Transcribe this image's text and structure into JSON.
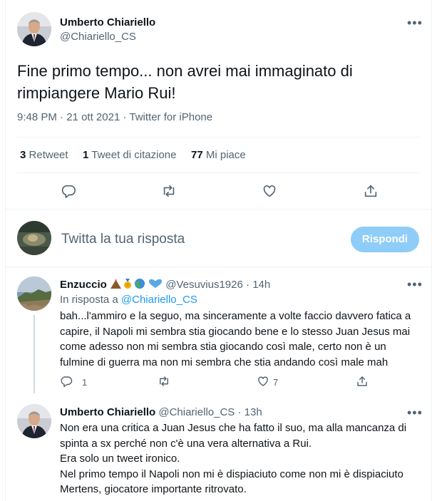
{
  "main_tweet": {
    "author_name": "Umberto Chiariello",
    "handle": "@Chiariello_CS",
    "text_line1": "Fine primo tempo... non avrei mai immaginato di",
    "text_line2": "rimpiangere Mario Rui!",
    "time": "9:48 PM",
    "date": "21 ott 2021",
    "source": "Twitter for iPhone",
    "sep": "·",
    "retweets_count": "3",
    "retweets_label": "Retweet",
    "quotes_count": "1",
    "quotes_label": "Tweet di citazione",
    "likes_count": "77",
    "likes_label": "Mi piace",
    "more": "•••"
  },
  "compose": {
    "placeholder": "Twitta la tua risposta",
    "button_label": "Rispondi"
  },
  "replies": [
    {
      "author_name": "Enzuccio",
      "handle": "@Vesuvius1926",
      "sep": "·",
      "time": "14h",
      "reply_prefix": "In risposta a ",
      "reply_to": "@Chiariello_CS",
      "lines": [
        "bah...l'ammiro e la seguo, ma sinceramente a volte faccio davvero fatica a",
        "capire, il Napoli mi sembra stia giocando bene e lo stesso Juan Jesus mai",
        "come adesso non mi sembra stia giocando così male, certo non è un",
        "fulmine di guerra ma non mi sembra che stia andando così male mah"
      ],
      "reply_count": "1",
      "like_count": "7",
      "more": "•••"
    },
    {
      "author_name": "Umberto Chiariello",
      "handle": "@Chiariello_CS",
      "sep": "·",
      "time": "13h",
      "lines": [
        "Non era una critica a Juan Jesus che ha fatto il suo, ma alla mancanza di",
        "spinta a sx perché non c'è una vera alternativa a Rui.",
        "Era solo un tweet ironico.",
        "Nel primo tempo il Napoli non mi è dispiaciuto come non mi è dispiaciuto",
        "Mertens, giocatore importante ritrovato."
      ],
      "more": "•••"
    }
  ],
  "icons": {
    "reply": "reply-icon",
    "retweet": "retweet-icon",
    "like": "like-icon",
    "share": "share-icon"
  },
  "colors": {
    "link": "#1d9bf0",
    "muted": "#536471",
    "button_disabled": "#8ecdf7"
  }
}
